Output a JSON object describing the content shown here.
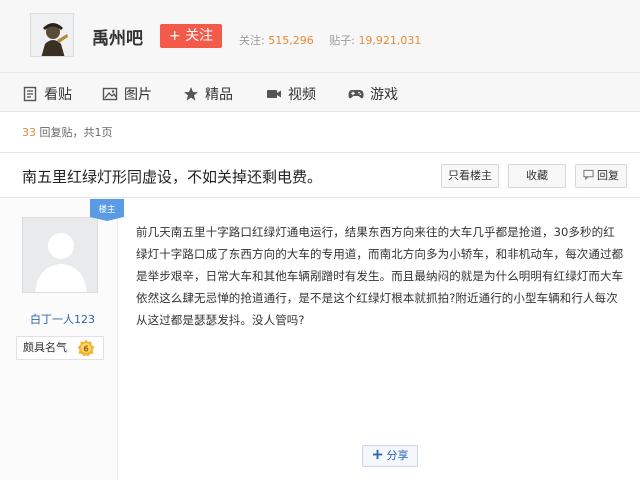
{
  "header": {
    "forum_name": "禹州吧",
    "follow_label": "+ 关注",
    "follow_count_label": "关注:",
    "follow_count": "515,296",
    "post_count_label": "贴子:",
    "post_count": "19,921,031"
  },
  "nav": {
    "items": [
      {
        "label": "看贴",
        "icon": "document-icon"
      },
      {
        "label": "图片",
        "icon": "image-icon"
      },
      {
        "label": "精品",
        "icon": "star-icon"
      },
      {
        "label": "视频",
        "icon": "video-icon"
      },
      {
        "label": "游戏",
        "icon": "gamepad-icon"
      }
    ]
  },
  "reply_info": {
    "count": "33",
    "text": "回复贴，共1页"
  },
  "thread": {
    "title": "南五里红绿灯形同虚设，不如关掉还剩电费。",
    "only_author_label": "只看楼主",
    "favorite_label": "收藏",
    "reply_label": "回复"
  },
  "post": {
    "badge": "楼主",
    "author": "白丁一人123",
    "rank_title": "颇具名气",
    "level": "6",
    "content": "前几天南五里十字路口红绿灯通电运行，结果东西方向来往的大车几乎都是抢道，30多秒的红绿灯十字路口成了东西方向的大车的专用道，而南北方向多为小轿车，和非机动车，每次通过都是举步艰辛，日常大车和其他车辆剐蹭时有发生。而且最纳闷的就是为什么明明有红绿灯而大车依然这么肆无忌惮的抢道通行，是不是这个红绿灯根本就抓拍?附近通行的小型车辆和行人每次从这过都是瑟瑟发抖。没人管吗?",
    "share_label": "分享"
  },
  "colors": {
    "accent_red": "#f35a4a",
    "link_blue": "#2d64b3",
    "number_orange": "#e48b3b"
  }
}
